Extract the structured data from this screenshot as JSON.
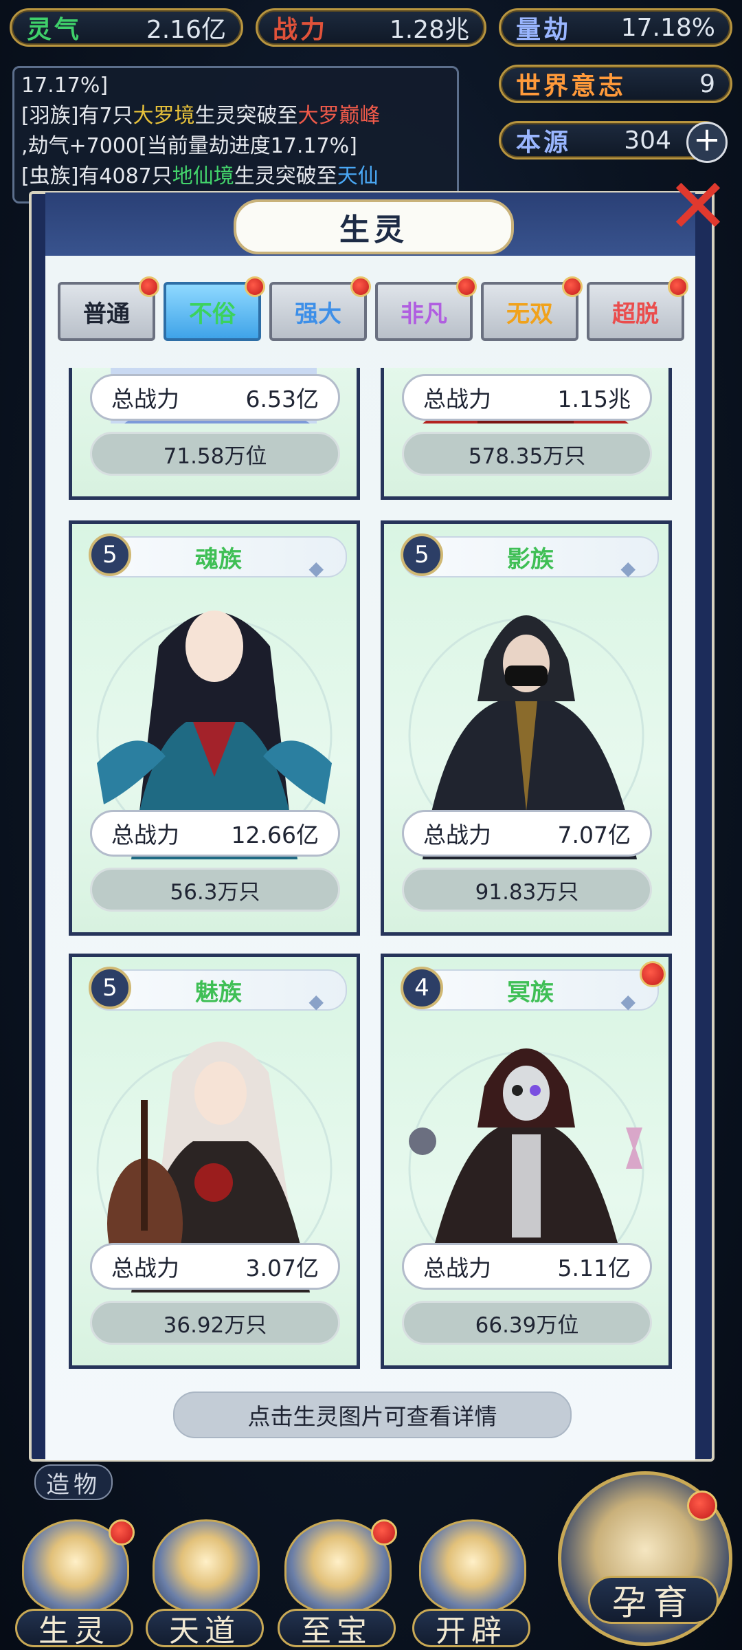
{
  "stats": {
    "lingqi": {
      "label": "灵气",
      "value": "2.16亿",
      "color": "#3fd06a"
    },
    "zhanli": {
      "label": "战力",
      "value": "1.28兆",
      "color": "#e0523a"
    },
    "liangjie": {
      "label": "量劫",
      "value": "17.18%",
      "color": "#9ab6ff"
    },
    "shijie": {
      "label": "世界意志",
      "value": "9",
      "color": "#ff9a3a"
    },
    "benyuan": {
      "label": "本源",
      "value": "304",
      "color": "#9ab6ff"
    }
  },
  "log": {
    "line0": "17.17%]",
    "line1_a": "[羽族]有7只",
    "line1_b": "大罗境",
    "line1_c": "生灵突破至",
    "line1_d": "大罗巅峰",
    "line2": ",劫气+7000[当前量劫进度17.17%]",
    "line3_a": "[虫族]有4087只",
    "line3_b": "地仙境",
    "line3_c": "生灵突破至",
    "line3_d": "天仙"
  },
  "modal": {
    "title": "生灵",
    "close_icon": "close-x-icon",
    "hint": "点击生灵图片可查看详情"
  },
  "tabs": [
    {
      "label": "普通",
      "color": "#1d2433"
    },
    {
      "label": "不俗",
      "color": "#3bd25e"
    },
    {
      "label": "强大",
      "color": "#3d8fe8"
    },
    {
      "label": "非凡",
      "color": "#b05ee0"
    },
    {
      "label": "无双",
      "color": "#f0a21c"
    },
    {
      "label": "超脱",
      "color": "#ea4d4d"
    }
  ],
  "cards": [
    {
      "name": "",
      "level": "",
      "power_label": "总战力",
      "power": "6.53亿",
      "count": "71.58万位"
    },
    {
      "name": "",
      "level": "",
      "power_label": "总战力",
      "power": "1.15兆",
      "count": "578.35万只"
    },
    {
      "name": "魂族",
      "level": "5",
      "power_label": "总战力",
      "power": "12.66亿",
      "count": "56.3万只"
    },
    {
      "name": "影族",
      "level": "5",
      "power_label": "总战力",
      "power": "7.07亿",
      "count": "91.83万只"
    },
    {
      "name": "魅族",
      "level": "5",
      "power_label": "总战力",
      "power": "3.07亿",
      "count": "36.92万只"
    },
    {
      "name": "冥族",
      "level": "4",
      "power_label": "总战力",
      "power": "5.11亿",
      "count": "66.39万位"
    }
  ],
  "side": {
    "label": "造物"
  },
  "nav": [
    {
      "label": "生灵"
    },
    {
      "label": "天道"
    },
    {
      "label": "至宝"
    },
    {
      "label": "开辟"
    },
    {
      "label": "孕育"
    }
  ]
}
